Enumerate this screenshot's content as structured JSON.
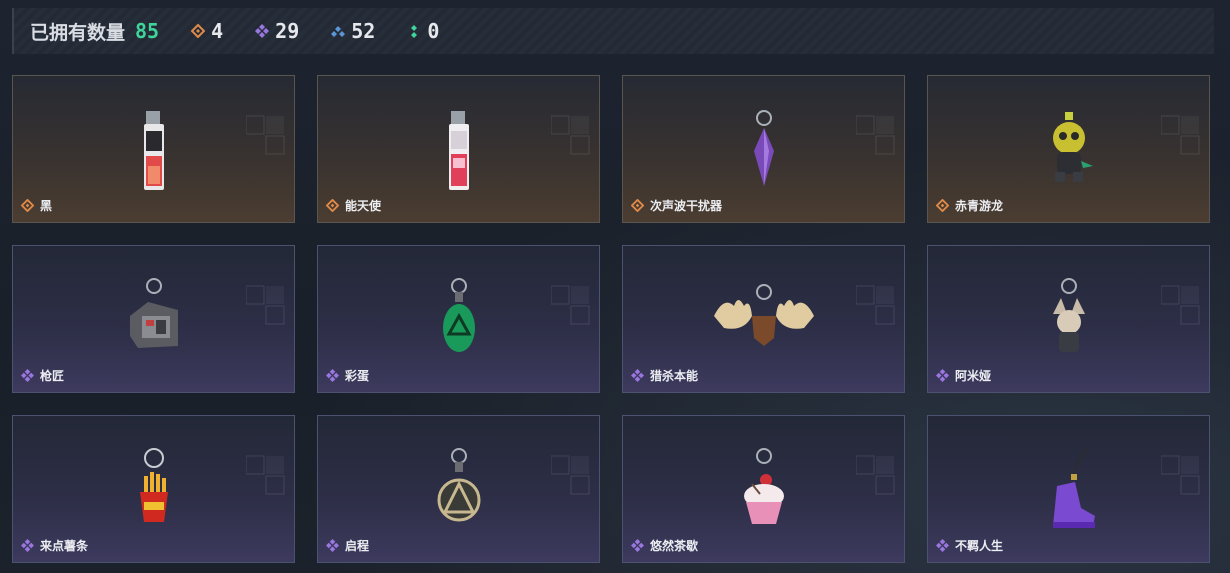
{
  "header": {
    "owned_label": "已拥有数量",
    "owned_count": "85",
    "stats": [
      {
        "icon": "orange-diamond-icon",
        "value": "4",
        "color": "#e08a48"
      },
      {
        "icon": "purple-diamond-icon",
        "value": "29",
        "color": "#9a76e0"
      },
      {
        "icon": "blue-diamond-icon",
        "value": "52",
        "color": "#5a96d8"
      },
      {
        "icon": "green-diamond-icon",
        "value": "0",
        "color": "#3fd49a"
      }
    ]
  },
  "colors": {
    "orange_rarity": "#e08a48",
    "purple_rarity": "#9a76e0",
    "accent_green": "#3fd49a"
  },
  "items": [
    {
      "name": "黑",
      "rarity": "orange",
      "art": "vape-tag-pendant-icon"
    },
    {
      "name": "能天使",
      "rarity": "orange",
      "art": "vape-tag-pendant-icon"
    },
    {
      "name": "次声波干扰器",
      "rarity": "orange",
      "art": "purple-crystal-pendant-icon"
    },
    {
      "name": "赤青游龙",
      "rarity": "orange",
      "art": "dragon-figure-pendant-icon"
    },
    {
      "name": "枪匠",
      "rarity": "purple",
      "art": "gun-case-pendant-icon"
    },
    {
      "name": "彩蛋",
      "rarity": "purple",
      "art": "green-egg-pendant-icon"
    },
    {
      "name": "猎杀本能",
      "rarity": "purple",
      "art": "moose-antler-pendant-icon"
    },
    {
      "name": "阿米娅",
      "rarity": "purple",
      "art": "bunny-figure-pendant-icon"
    },
    {
      "name": "来点薯条",
      "rarity": "purple",
      "art": "fries-pendant-icon"
    },
    {
      "name": "启程",
      "rarity": "purple",
      "art": "triangle-medal-pendant-icon"
    },
    {
      "name": "悠然茶歇",
      "rarity": "purple",
      "art": "cupcake-pendant-icon"
    },
    {
      "name": "不羁人生",
      "rarity": "purple",
      "art": "sneaker-pendant-icon"
    }
  ]
}
